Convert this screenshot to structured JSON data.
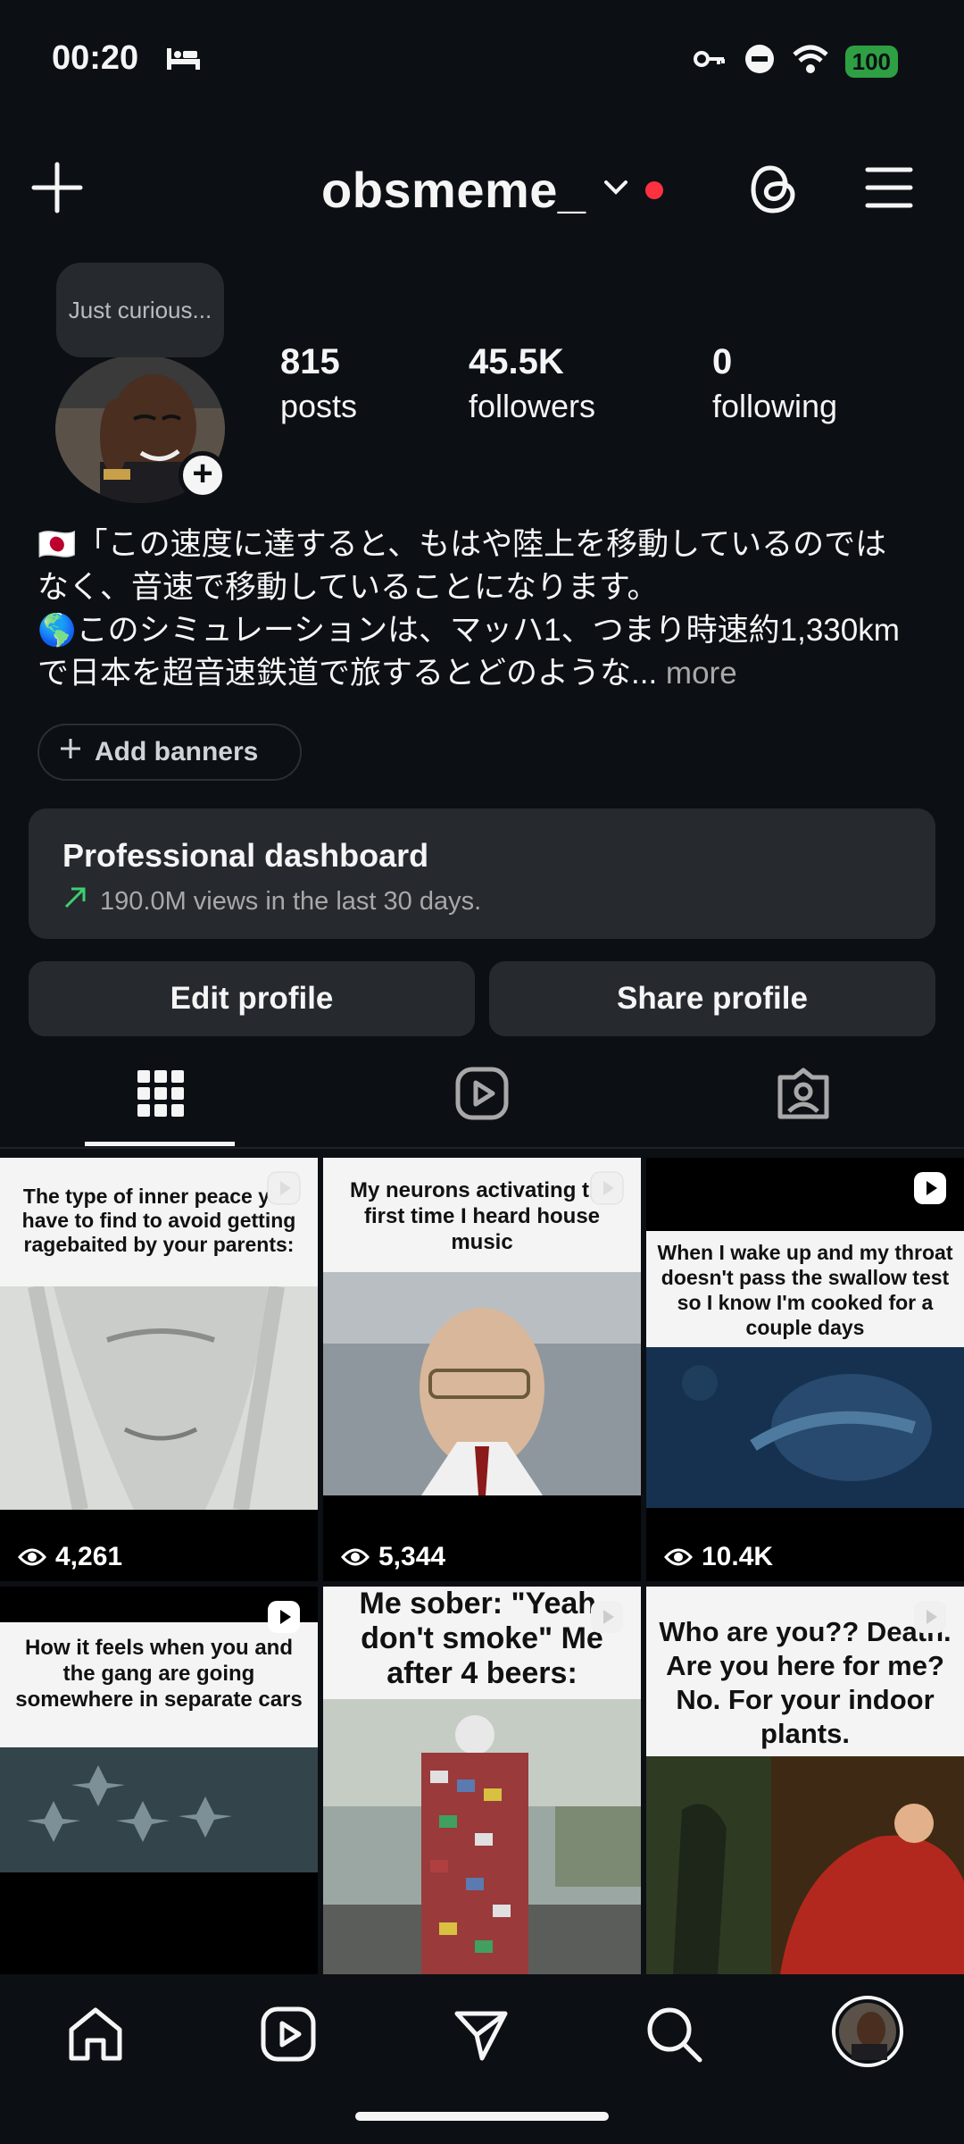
{
  "status_bar": {
    "time": "00:20",
    "battery": "100"
  },
  "header": {
    "username": "obsmeme_"
  },
  "profile": {
    "note": "Just curious...",
    "stats": [
      {
        "value": "815",
        "label": "posts"
      },
      {
        "value": "45.5K",
        "label": "followers"
      },
      {
        "value": "0",
        "label": "following"
      }
    ],
    "bio_line1": "🇯🇵「この速度に達すると、もはや陸上を移動しているのでは",
    "bio_line2": "なく、音速で移動していることになります。",
    "bio_line3": "🌎このシミュレーションは、マッハ1、つまり時速約1,330km",
    "bio_line4": "で日本を超音速鉄道で旅するとどのような...",
    "bio_more": " more",
    "add_banners": "Add banners"
  },
  "dashboard": {
    "title": "Professional dashboard",
    "subtitle": "190.0M views in the last 30 days."
  },
  "buttons": {
    "edit": "Edit profile",
    "share": "Share profile"
  },
  "posts": [
    {
      "caption": "The type of inner peace you have to find to avoid getting ragebaited by your parents:",
      "views": "4,261"
    },
    {
      "caption": "My neurons activating the first time I heard house music",
      "views": "5,344"
    },
    {
      "caption": "When I wake up and my throat doesn't pass the swallow test so I know I'm cooked for a couple days",
      "views": "10.4K"
    },
    {
      "caption": "How it feels when you and the gang are going somewhere in separate cars",
      "views": ""
    },
    {
      "caption": "Me sober: \"Yeah, don't smoke\" Me after 4 beers:",
      "views": ""
    },
    {
      "caption": "Who are you?? Death. Are you here for me? No. For your indoor plants.",
      "views": ""
    }
  ],
  "colors": {
    "background": "#0c1014",
    "card": "#262a2f",
    "notification": "#ff3040",
    "battery": "#2ea043",
    "trend": "#3ecf71"
  }
}
